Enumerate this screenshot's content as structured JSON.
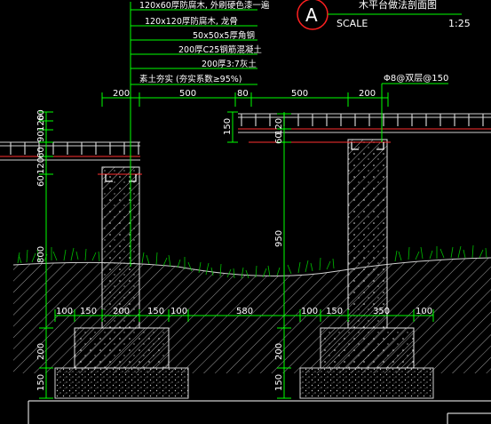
{
  "title_block": {
    "symbol": "A",
    "title": "木平台做法剖面图",
    "scale_label": "SCALE",
    "scale_value": "1:25"
  },
  "layers": [
    "120x60厚防腐木, 外刷硬色漆一遍",
    "120x120厚防腐木, 龙骨",
    "50x50x5厚角钢",
    "200厚C25钢筋混凝土",
    "200厚3:7灰土",
    "素土夯实 (夯实系数≥95%)"
  ],
  "rebar_note": "Φ8@双层@150",
  "top_dims": [
    "200",
    "500",
    "80",
    "500",
    "200"
  ],
  "left_vertical_dims": [
    "120",
    "60",
    "90",
    "60",
    "120",
    "60",
    "800",
    "200",
    "150"
  ],
  "right_vertical_dims": [
    "150",
    "120",
    "60",
    "950",
    "200",
    "150"
  ],
  "footing_dims_left": [
    "100",
    "150",
    "200",
    "150",
    "100"
  ],
  "between_dim": "580",
  "footing_dims_right": [
    "100",
    "150",
    "350",
    "100"
  ],
  "colors": {
    "background": "#000000",
    "leader": "#00ff00",
    "dimension": "#00ff00",
    "text": "#ffffff",
    "grass": "#00cc00",
    "hatch": "#b5b5b5",
    "deck": "#ff4040",
    "title_circle": "#ff2020",
    "border": "#ffffff"
  }
}
